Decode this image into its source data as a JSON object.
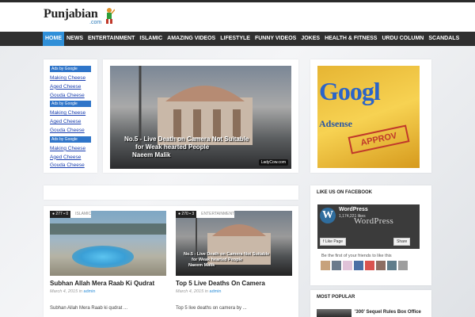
{
  "site": {
    "logo": "Punjabian",
    "logo_suffix": ".com"
  },
  "nav": {
    "items": [
      "HOME",
      "NEWS",
      "ENTERTAINMENT",
      "ISLAMIC",
      "AMAZING VIDEOS",
      "LIFESTYLE",
      "FUNNY VIDEOS",
      "JOKES",
      "HEALTH & FITNESS",
      "URDU COLUMN",
      "SCANDALS"
    ],
    "active": "HOME"
  },
  "ads": {
    "groups": [
      {
        "title": "Ads by Google",
        "links": [
          "Making Cheese",
          "Aged Cheese",
          "Gouda Cheese"
        ]
      },
      {
        "title": "Ads by Google",
        "links": [
          "Making Cheese",
          "Aged Cheese",
          "Gouda Cheese"
        ]
      },
      {
        "title": "Ads by Google",
        "links": [
          "Making Cheese",
          "Aged Cheese",
          "Gouda Cheese"
        ]
      }
    ]
  },
  "featured_video": {
    "caption_line1": "No.5 - Live Death on Camera  Not Suitable",
    "caption_line2": "for Weak hearted People",
    "caption_line3": "Naeem Malik",
    "watermark": "LadyCow.com"
  },
  "google_ad": {
    "word": "Googl",
    "subword": "Adsense",
    "stamp": "APPROV"
  },
  "posts": [
    {
      "views": "277",
      "comments": "0",
      "category": "ISLAMIC",
      "title": "Subhan Allah Mera Raab Ki Qudrat",
      "date": "March 4, 2015",
      "author": "admin",
      "excerpt": "Subhan Allah Mera Raab ki qudrat ..."
    },
    {
      "views": "270",
      "comments": "3",
      "category": "ENTERTAINMENT",
      "title": "Top 5 Live Deaths On Camera",
      "date": "March 4, 2015",
      "author": "admin",
      "excerpt": "Top 5 live deaths on camera by ...",
      "thumb_caption_line1": "No.5 - Live Death on Camera  Not Suitable",
      "thumb_caption_line2": "for Weak hearted People",
      "thumb_caption_line3": "Naeem Malik"
    }
  ],
  "facebook": {
    "title": "LIKE US ON FACEBOOK",
    "page_name": "WordPress",
    "likes": "1,174,221 likes",
    "wp_word": "WordPress",
    "like_btn": "Like Page",
    "share_btn": "Share",
    "friends_text": "Be the first of your friends to like this"
  },
  "popular": {
    "title": "MOST POPULAR",
    "item": "'300' Sequel Rules Box Office"
  },
  "colors": {
    "accent": "#2f8fd8",
    "nav_bg": "#2f2f2f",
    "ads_title_bg": "#2f75c9"
  },
  "meta_sep": "in",
  "icons": {
    "views": "eye-icon",
    "comments": "comment-icon"
  }
}
